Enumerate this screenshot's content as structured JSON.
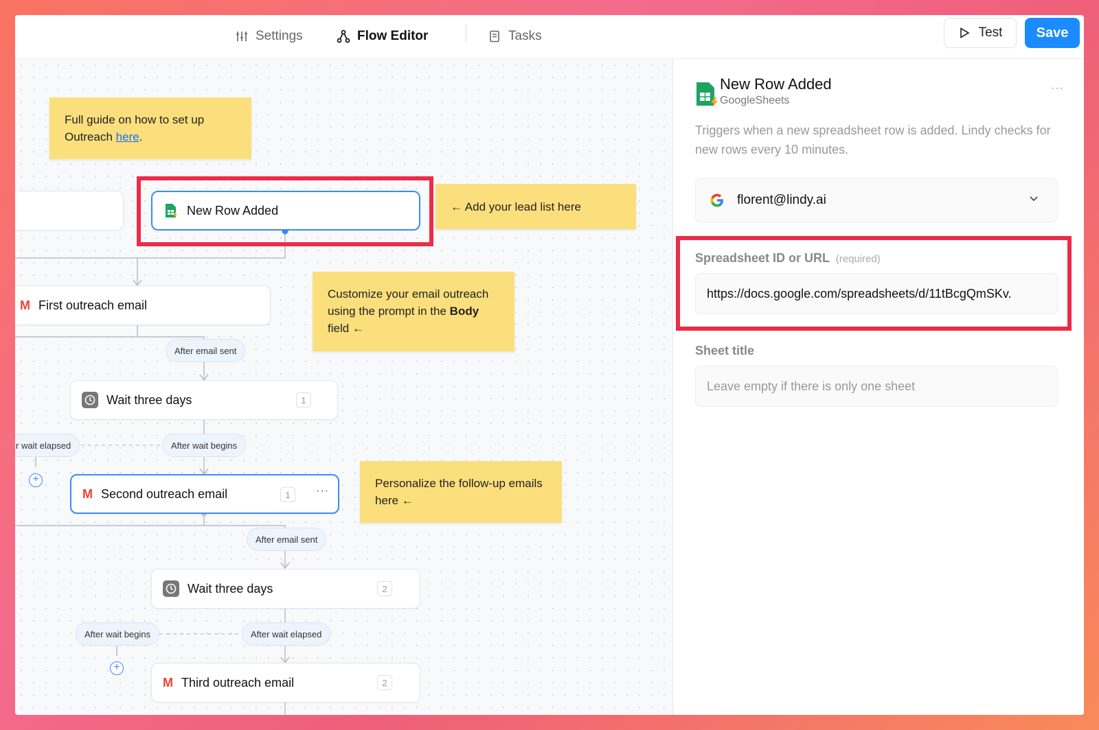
{
  "topbar": {
    "tabs": [
      {
        "label": "Settings",
        "icon": "sliders-icon"
      },
      {
        "label": "Flow Editor",
        "icon": "flow-icon"
      },
      {
        "label": "Tasks",
        "icon": "tasks-icon"
      }
    ],
    "test_label": "Test",
    "save_label": "Save"
  },
  "canvas": {
    "notes": {
      "guide_text": "Full guide on how to set up Outreach ",
      "guide_link": "here",
      "guide_end": ".",
      "lead_list": "← Add your lead list here",
      "customize_1": "Customize your email outreach using the prompt in the ",
      "customize_bold": "Body",
      "customize_2": " field ←",
      "personalize": "Personalize the follow-up emails here ←"
    },
    "nodes": {
      "trigger": "New Row Added",
      "first_email": "First outreach email",
      "wait1": "Wait three days",
      "wait1_badge": "1",
      "second_email": "Second outreach email",
      "second_badge": "1",
      "wait2": "Wait three days",
      "wait2_badge": "2",
      "third_email": "Third outreach email",
      "third_badge": "2",
      "more": "···"
    },
    "pills": {
      "after_email_sent_1": "After email sent",
      "after_wait_elapsed_1": "r wait elapsed",
      "after_wait_begins_1": "After wait begins",
      "after_email_sent_2": "After email sent",
      "after_wait_begins_2": "After wait begins",
      "after_wait_elapsed_2": "After wait elapsed"
    }
  },
  "panel": {
    "title": "New Row Added",
    "subtitle": "GoogleSheets",
    "more": "···",
    "description": "Triggers when a new spreadsheet row is added. Lindy checks for new rows every 10 minutes.",
    "account": "florent@lindy.ai",
    "spreadsheet_label": "Spreadsheet ID or URL",
    "spreadsheet_required": "(required)",
    "spreadsheet_value": "https://docs.google.com/spreadsheets/d/11tBcgQmSKv.",
    "sheet_title_label": "Sheet title",
    "sheet_title_placeholder": "Leave empty if there is only one sheet"
  },
  "colors": {
    "accent": "#1a8cff",
    "highlight": "#ec2b48",
    "sticky": "#fbdf7c"
  }
}
